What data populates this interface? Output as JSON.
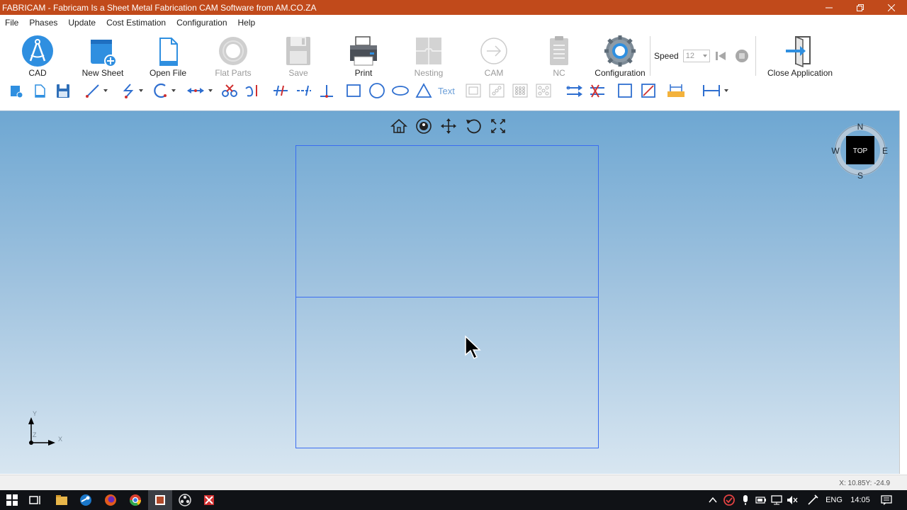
{
  "window": {
    "title": "FABRICAM - Fabricam Is a Sheet Metal Fabrication CAM Software from AM.CO.ZA",
    "title_bar_color": "#c14a1b",
    "controls": [
      "minimize-icon",
      "restore-icon",
      "close-icon"
    ]
  },
  "menu": [
    "File",
    "Phases",
    "Update",
    "Cost Estimation",
    "Configuration",
    "Help"
  ],
  "main_toolbar": {
    "buttons": [
      {
        "label": "CAD",
        "icon": "compass-icon",
        "enabled": true
      },
      {
        "label": "New Sheet",
        "icon": "new-sheet-icon",
        "enabled": true
      },
      {
        "label": "Open File",
        "icon": "open-file-icon",
        "enabled": true
      },
      {
        "label": "Flat Parts",
        "icon": "flat-parts-icon",
        "enabled": false
      },
      {
        "label": "Save",
        "icon": "save-disk-icon",
        "enabled": false
      },
      {
        "label": "Print",
        "icon": "printer-icon",
        "enabled": true
      },
      {
        "label": "Nesting",
        "icon": "nesting-puzzle-icon",
        "enabled": false
      },
      {
        "label": "CAM",
        "icon": "cam-arrow-icon",
        "enabled": false
      },
      {
        "label": "NC",
        "icon": "nc-clipboard-icon",
        "enabled": false
      },
      {
        "label": "Configuration",
        "icon": "configuration-gear-icon",
        "enabled": true
      }
    ],
    "speed": {
      "label": "Speed",
      "value": "12"
    },
    "close": {
      "label": "Close Application",
      "icon": "exit-door-icon"
    }
  },
  "drawing_toolbar": {
    "text_tool_label": "Text",
    "tools": [
      "new-icon",
      "open-icon",
      "save-icon",
      "line-icon",
      "polyline-icon",
      "arc-icon",
      "dimension-arrow-icon",
      "trim-scissors-icon",
      "break-icon",
      "extend-icon",
      "offset-icon",
      "perpendicular-icon",
      "rectangle-icon",
      "circle-icon",
      "ellipse-icon",
      "triangle-icon",
      "text-icon",
      "pattern-square-icon",
      "pattern-diagonal-icon",
      "pattern-grid-icon",
      "pattern-cross-icon",
      "transfer-icon",
      "remove-transfer-icon",
      "frame-icon",
      "frame-diagonal-icon",
      "measure-icon",
      "ruler-icon"
    ]
  },
  "viewport": {
    "nav_icons": [
      "home-icon",
      "orbit-icon",
      "pan-icon",
      "rotate-icon",
      "fit-extents-icon"
    ],
    "viewcube": {
      "face": "TOP",
      "north": "N",
      "south": "S",
      "east": "E",
      "west": "W"
    },
    "axis": {
      "x": "X",
      "y": "Y",
      "z": "Z"
    },
    "sheet_color": "#3b6df0"
  },
  "status": {
    "coords": "X: 10.85Y: -24.9"
  },
  "taskbar": {
    "apps": [
      "windows-start-icon",
      "task-view-icon",
      "file-explorer-icon",
      "steam-icon",
      "firefox-icon",
      "chrome-icon",
      "fabricam-icon",
      "obs-icon",
      "game-icon"
    ],
    "tray": {
      "language": "ENG",
      "time": "14:05"
    }
  }
}
